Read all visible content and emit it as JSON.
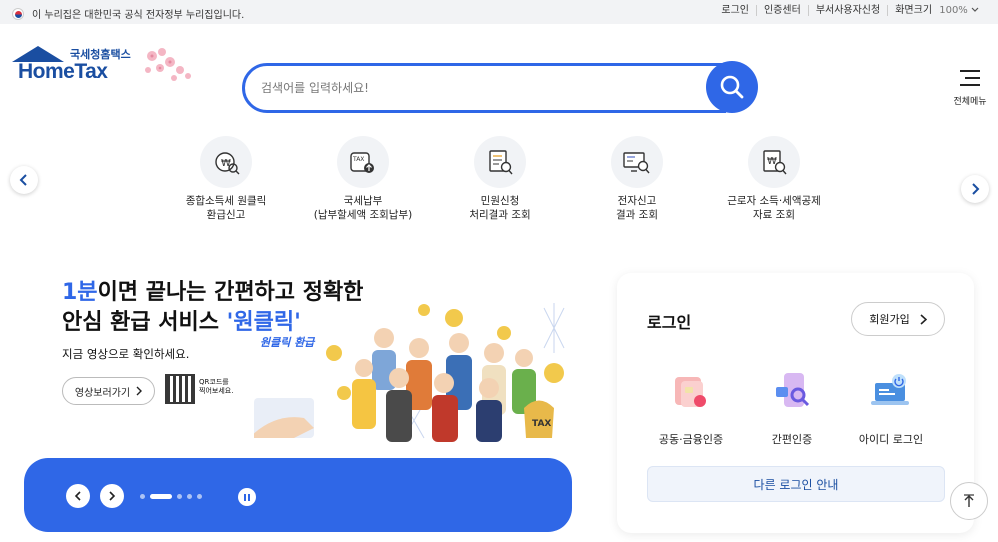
{
  "topbar": {
    "gov_notice": "이 누리집은 대한민국 공식 전자정부 누리집입니다.",
    "links": [
      "로그인",
      "인증센터",
      "부서사용자신청",
      "화면크기"
    ],
    "zoom": "100%"
  },
  "logo": {
    "sub": "국세청홈택스",
    "main": "HomeTax"
  },
  "search": {
    "placeholder": "검색어를 입력하세요!"
  },
  "menu": {
    "label": "전체메뉴"
  },
  "quick_menu": [
    {
      "label": "종합소득세 원클릭\n환급신고",
      "icon": "won-receipt-search-icon"
    },
    {
      "label": "국세납부\n(납부할세액 조회납부)",
      "icon": "tax-payment-icon"
    },
    {
      "label": "민원신청\n처리결과 조회",
      "icon": "document-search-icon"
    },
    {
      "label": "전자신고\n결과 조회",
      "icon": "monitor-search-icon"
    },
    {
      "label": "근로자 소득·세액공제\n자료 조회",
      "icon": "won-document-search-icon"
    }
  ],
  "banner": {
    "title_highlight": "1분",
    "title_line1_rest": "이면 끝나는 간편하고 정확한",
    "title_line2_pre": "안심 환급 서비스 ",
    "title_line2_highlight": "'원클릭'",
    "subtitle": "지금 영상으로 확인하세요.",
    "video_button": "영상보러가기",
    "qr_text": "QR코드를\n찍어보세요.",
    "badge": "원클릭 환급",
    "tax_bag": "TAX"
  },
  "login": {
    "title": "로그인",
    "join": "회원가입",
    "options": [
      {
        "label": "공동·금융인증",
        "icon": "certificate-card-icon"
      },
      {
        "label": "간편인증",
        "icon": "mobile-auth-icon"
      },
      {
        "label": "아이디 로그인",
        "icon": "id-login-laptop-icon"
      }
    ],
    "other": "다른 로그인 안내"
  },
  "colors": {
    "primary": "#2f67e7",
    "brand": "#1a4ea1"
  }
}
